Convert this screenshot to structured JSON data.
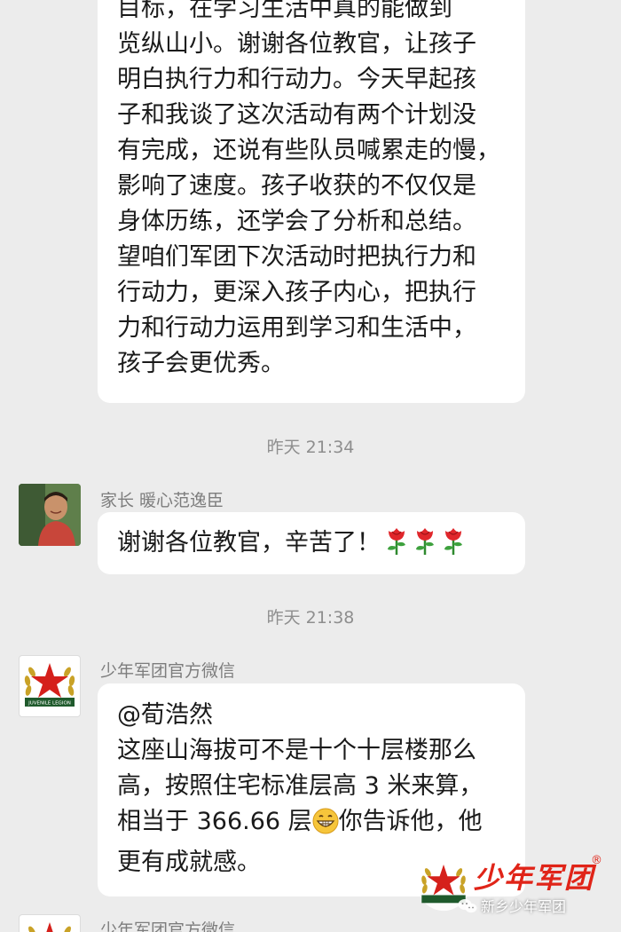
{
  "messages": {
    "first": {
      "lines": [
        "目标，在学习生活中真的能做到",
        "览纵山小。谢谢各位教官，让孩子",
        "明白执行力和行动力。今天早起孩",
        "子和我谈了这次活动有两个计划没",
        "有完成，还说有些队员喊累走的慢，",
        "影响了速度。孩子收获的不仅仅是",
        "身体历练，还学会了分析和总结。",
        "望咱们军团下次活动时把执行力和",
        "行动力，更深入孩子内心，把执行",
        "力和行动力运用到学习和生活中，",
        "孩子会更优秀。"
      ]
    },
    "timestamp_1": "昨天 21:34",
    "parent_message": {
      "sender": "家长 暖心范逸臣",
      "text": "谢谢各位教官，辛苦了！",
      "emoji": "rose-icon"
    },
    "timestamp_2": "昨天 21:38",
    "official_message": {
      "sender": "少年军团官方微信",
      "mention": "@荀浩然",
      "lines": [
        "这座山海拔可不是十个十层楼那么",
        "高，按照住宅标准层高 3 米来算，"
      ],
      "line3_before": "相当于 366.66 层",
      "line3_emoji": "grin-icon",
      "line3_after": "你告诉他，他",
      "line4": "更有成就感。"
    },
    "next_sender": "少年军团官方微信"
  },
  "logo": {
    "banner_text": "JUVENILE LEGION"
  },
  "watermark": {
    "title": "少年军团",
    "registered": "®",
    "account": "新乡少年军团"
  },
  "colors": {
    "background": "#ececec",
    "bubble": "#ffffff",
    "brand_red": "#e02418",
    "banner_green": "#1f5a2c",
    "laurel_gold": "#c9a227"
  }
}
